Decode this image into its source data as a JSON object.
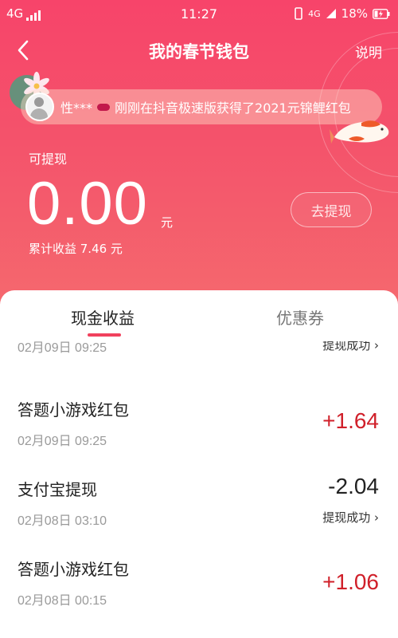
{
  "status_bar": {
    "network": "4G",
    "time": "11:27",
    "network2": "4G",
    "battery": "18%"
  },
  "nav": {
    "title": "我的春节钱包",
    "help": "说明"
  },
  "ticker": {
    "user": "性***",
    "message": "刚刚在抖音极速版获得了2021元锦鲤红包"
  },
  "wallet": {
    "withdrawable_label": "可提现",
    "balance": "0.00",
    "unit": "元",
    "cumulative": "累计收益 7.46 元",
    "withdraw_button": "去提现"
  },
  "tabs": [
    {
      "label": "现金收益"
    },
    {
      "label": "优惠券"
    }
  ],
  "transactions": [
    {
      "title": "",
      "time": "02月09日 09:25",
      "amount": "",
      "status": "提现成功 ›"
    },
    {
      "title": "答题小游戏红包",
      "time": "02月09日 09:25",
      "amount": "+1.64",
      "status": ""
    },
    {
      "title": "支付宝提现",
      "time": "02月08日 03:10",
      "amount": "-2.04",
      "status": "提现成功 ›"
    },
    {
      "title": "答题小游戏红包",
      "time": "02月08日 00:15",
      "amount": "+1.06",
      "status": ""
    }
  ],
  "colors": {
    "accent": "#f1415d",
    "income": "#d0202a",
    "expense": "#222222",
    "header_top": "#f7446a",
    "header_bottom": "#f56a6e"
  }
}
